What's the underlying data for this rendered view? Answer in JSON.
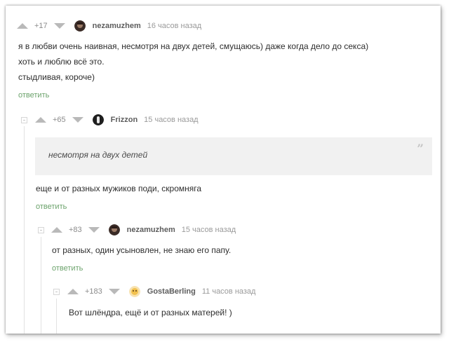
{
  "comments": [
    {
      "rating": "+17",
      "user": "nezamuzhem",
      "time": "16 часов назад",
      "lines": [
        "я в любви очень наивная, несмотря на двух детей, смущаюсь) даже когда дело до секса)",
        "хоть и люблю всё это.",
        "стыдливая, короче)"
      ],
      "reply": "ответить"
    },
    {
      "rating": "+65",
      "user": "Frizzon",
      "time": "15 часов назад",
      "quote": "несмотря на двух детей",
      "quote_mark": "”",
      "lines": [
        "еще и от разных мужиков поди, скромняга"
      ],
      "reply": "ответить"
    },
    {
      "rating": "+83",
      "user": "nezamuzhem",
      "time": "15 часов назад",
      "lines": [
        "от разных, один усыновлен, не знаю его папу."
      ],
      "reply": "ответить"
    },
    {
      "rating": "+183",
      "user": "GostaBerling",
      "time": "11 часов назад",
      "lines": [
        "Вот шлёндра, ещё и от разных матерей! )"
      ]
    }
  ],
  "colors": {
    "reply_link": "#6ca36c",
    "username": "#5d5d5d",
    "arrow": "#b9b9b9",
    "quote_bg": "#f1f1f1"
  }
}
